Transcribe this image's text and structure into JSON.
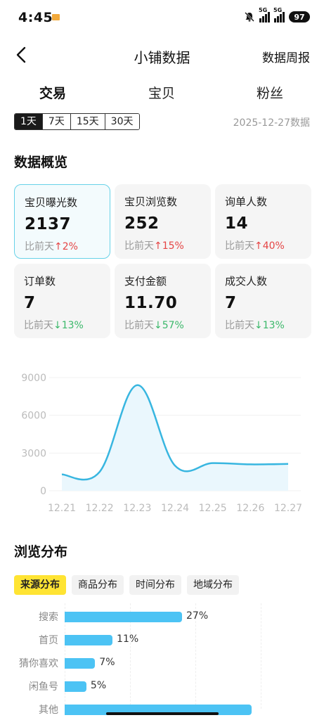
{
  "status_bar": {
    "time": "4:45",
    "network1": "5G",
    "network2": "5G",
    "battery": "97"
  },
  "nav": {
    "title": "小铺数据",
    "right_action": "数据周报"
  },
  "main_tabs": [
    {
      "label": "交易",
      "active": true
    },
    {
      "label": "宝贝",
      "active": false
    },
    {
      "label": "粉丝",
      "active": false
    }
  ],
  "ranges": [
    {
      "label": "1天",
      "active": true
    },
    {
      "label": "7天",
      "active": false
    },
    {
      "label": "15天",
      "active": false
    },
    {
      "label": "30天",
      "active": false
    }
  ],
  "date_label": "2025-12-27数据",
  "overview": {
    "title": "数据概览",
    "cards": [
      {
        "label": "宝贝曝光数",
        "value": "2137",
        "compare_prefix": "比前天",
        "arrow": "↑",
        "change": "2%",
        "direction": "up",
        "active": true
      },
      {
        "label": "宝贝浏览数",
        "value": "252",
        "compare_prefix": "比前天",
        "arrow": "↑",
        "change": "15%",
        "direction": "up",
        "active": false
      },
      {
        "label": "询单人数",
        "value": "14",
        "compare_prefix": "比前天",
        "arrow": "↑",
        "change": "40%",
        "direction": "up",
        "active": false
      },
      {
        "label": "订单数",
        "value": "7",
        "compare_prefix": "比前天",
        "arrow": "↓",
        "change": "13%",
        "direction": "down",
        "active": false
      },
      {
        "label": "支付金额",
        "value": "11.70",
        "compare_prefix": "比前天",
        "arrow": "↓",
        "change": "57%",
        "direction": "down",
        "active": false
      },
      {
        "label": "成交人数",
        "value": "7",
        "compare_prefix": "比前天",
        "arrow": "↓",
        "change": "13%",
        "direction": "down",
        "active": false
      }
    ]
  },
  "chart_data": {
    "type": "area",
    "title": "",
    "xlabel": "",
    "ylabel": "",
    "categories": [
      "12.21",
      "12.22",
      "12.23",
      "12.24",
      "12.25",
      "12.26",
      "12.27"
    ],
    "series": [
      {
        "values": [
          1300,
          1500,
          8400,
          2000,
          2200,
          2100,
          2137
        ]
      }
    ],
    "y_ticks": [
      "9000",
      "6000",
      "3000",
      "0"
    ],
    "ylim": [
      0,
      9000
    ],
    "grid": true,
    "color": "#38b6e0",
    "fill": "#eaf7fd"
  },
  "distribution": {
    "title": "浏览分布",
    "tabs": [
      {
        "label": "来源分布",
        "active": true
      },
      {
        "label": "商品分布",
        "active": false
      },
      {
        "label": "时间分布",
        "active": false
      },
      {
        "label": "地域分布",
        "active": false
      }
    ],
    "bars": [
      {
        "label": "搜索",
        "value": 27,
        "text": "27%"
      },
      {
        "label": "首页",
        "value": 11,
        "text": "11%"
      },
      {
        "label": "猜你喜欢",
        "value": 7,
        "text": "7%"
      },
      {
        "label": "闲鱼号",
        "value": 5,
        "text": "5%"
      },
      {
        "label": "其他",
        "value": 43,
        "text": ""
      }
    ],
    "bar_color": "#4cc3f4"
  }
}
